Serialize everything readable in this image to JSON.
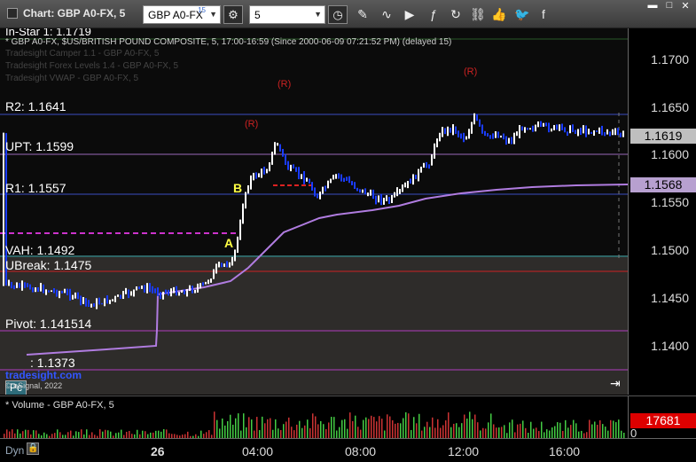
{
  "window": {
    "title": "Chart: GBP A0-FX, 5",
    "symbol": "GBP A0-FX",
    "symbol_sup": "15",
    "interval": "5"
  },
  "overlays": {
    "study_title": "In-Star 1: 1.1719",
    "symbol_line": "* GBP A0-FX, $US/BRITISH POUND COMPOSITE, 5, 17:00-16:59 (Since 2000-06-09 07:21:52 PM) (delayed 15)",
    "study_lines": [
      "Tradesight Camper 1.1 - GBP A0-FX, 5",
      "Tradesight Forex Levels 1.4 - GBP A0-FX, 5",
      "Tradesight VWAP - GBP A0-FX, 5"
    ],
    "levels": {
      "r2": "R2: 1.1641",
      "upt": "UPT: 1.1599",
      "r1": "R1: 1.1557",
      "vah": "VAH: 1.1492",
      "ubreak": "UBreak: 1.1475",
      "pivot": "Pivot: 1.141514",
      "s1": ": 1.1373"
    },
    "marker_r": "(R)",
    "marker_a": "A",
    "marker_b": "B",
    "brand": "tradesight.com",
    "copyright": "© eSignal, 2022",
    "pc_button": "Pc"
  },
  "price_axis": {
    "ticks": [
      "1.1700",
      "1.1650",
      "1.1600",
      "1.1550",
      "1.1500",
      "1.1450",
      "1.1400"
    ],
    "current_price": "1.1619",
    "vwap_price": "1.1568"
  },
  "volume": {
    "label": "* Volume - GBP A0-FX, 5",
    "current": "17681",
    "zero": "0"
  },
  "time_axis": {
    "dyn": "Dyn",
    "labels": [
      "26",
      "04:00",
      "08:00",
      "12:00",
      "16:00"
    ]
  },
  "colors": {
    "up_bar": "#ffffff",
    "down_bar": "#1a3cff",
    "vwap": "#b07ce0",
    "level_line": "#7a3c9c",
    "ubreak_line": "#cc2222",
    "vah_line": "#4fbfbf",
    "r_marker": "#cc2222",
    "ab_marker": "#ffff44",
    "count_digits": "#33cc33",
    "current_tag": "#bfbfbf",
    "vwap_tag": "#b7a0d0",
    "volume_tag": "#dd0000"
  }
}
